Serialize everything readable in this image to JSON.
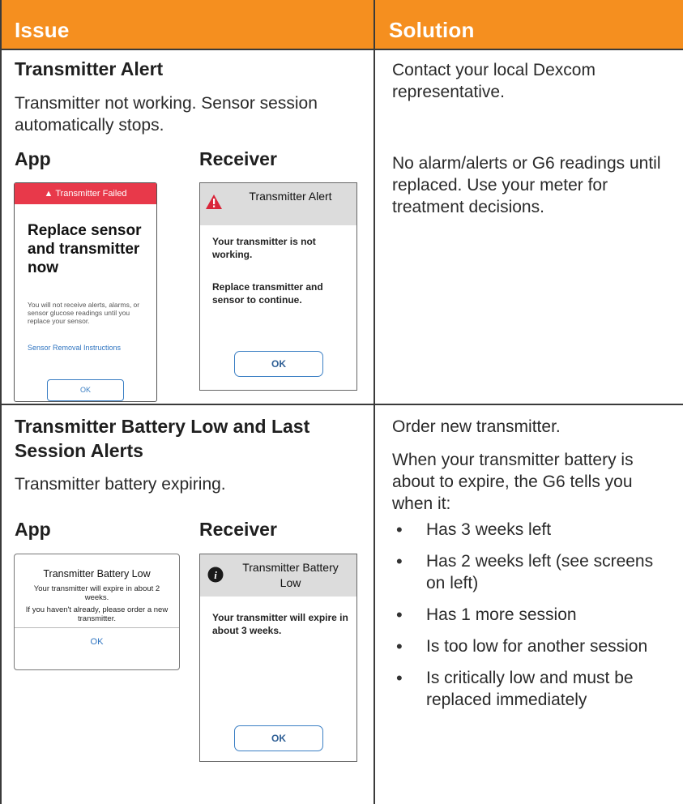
{
  "header": {
    "issue": "Issue",
    "solution": "Solution"
  },
  "row1": {
    "title": "Transmitter Alert",
    "description": "Transmitter not working. Sensor session automatically stops.",
    "app_label": "App",
    "receiver_label": "Receiver",
    "app_screen": {
      "banner": "Transmitter Failed",
      "heading": "Replace sensor and transmitter now",
      "message": "You will not receive alerts, alarms, or sensor glucose readings until you replace your sensor.",
      "link": "Sensor Removal Instructions",
      "button": "OK"
    },
    "receiver_screen": {
      "title": "Transmitter Alert",
      "line1": "Your transmitter is not working.",
      "line2": "Replace transmitter and sensor to continue.",
      "button": "OK"
    },
    "solution_1": "Contact your local Dexcom representative.",
    "solution_2": "No alarm/alerts or G6 readings until replaced. Use your meter for treatment decisions."
  },
  "row2": {
    "title": "Transmitter Battery Low and Last Session Alerts",
    "description": "Transmitter battery expiring.",
    "app_label": "App",
    "receiver_label": "Receiver",
    "app_screen": {
      "title": "Transmitter Battery Low",
      "message1": "Your transmitter will expire in about 2 weeks.",
      "message2": "If you haven't already, please order a new transmitter.",
      "button": "OK"
    },
    "receiver_screen": {
      "title": "Transmitter Battery Low",
      "message": "Your transmitter will expire in about 3 weeks.",
      "button": "OK"
    },
    "solution_1": "Order new transmitter.",
    "solution_2": "When your transmitter battery is about to expire, the G6 tells you when it:",
    "bullets": [
      "Has 3 weeks left",
      "Has 2 weeks left (see screens on left)",
      "Has 1 more session",
      "Is too low for another session",
      "Is critically low and must be replaced immediately"
    ]
  },
  "colors": {
    "header_orange": "#f58f1f",
    "banner_red": "#e8394a",
    "link_blue": "#2f74c0"
  }
}
